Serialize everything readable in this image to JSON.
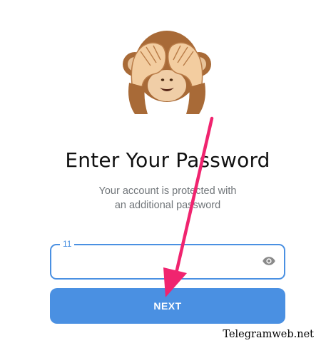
{
  "header": {
    "title": "Enter Your Password",
    "subtitle_line1": "Your account is protected with",
    "subtitle_line2": "an additional password",
    "mascot_icon": "monkey-covering-eyes-icon"
  },
  "password_field": {
    "label": "11",
    "value": "",
    "toggle_icon": "eye-icon"
  },
  "next_button": {
    "label": "NEXT"
  },
  "annotation": {
    "arrow_icon": "arrow-pointer-icon",
    "arrow_color": "#f0246f"
  },
  "watermark": {
    "text": "Telegramweb.net"
  },
  "colors": {
    "accent": "#4a90e2",
    "title": "#111111",
    "subtitle": "#707579"
  }
}
